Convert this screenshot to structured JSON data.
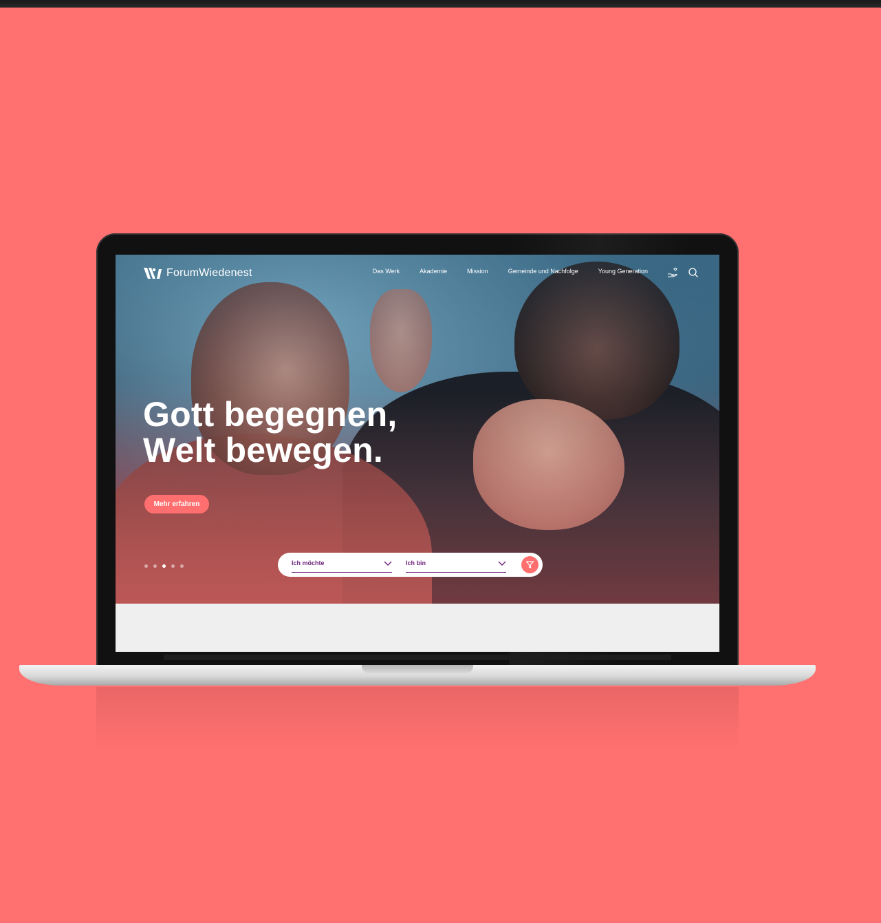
{
  "site": {
    "logo_text": "ForumWiedenest"
  },
  "nav": {
    "items": [
      {
        "label": "Das Werk"
      },
      {
        "label": "Akademie"
      },
      {
        "label": "Mission"
      },
      {
        "label": "Gemeinde und Nachfolge"
      },
      {
        "label": "Young Generation"
      }
    ],
    "icons": [
      "donate-icon",
      "search-icon"
    ]
  },
  "hero": {
    "headline_line1": "Gott begegnen,",
    "headline_line2": "Welt bewegen.",
    "cta_label": "Mehr erfahren",
    "slides": {
      "count": 5,
      "active_index": 2
    }
  },
  "filter": {
    "select1_label": "Ich möchte",
    "select2_label": "Ich bin",
    "button_icon": "filter-icon"
  },
  "colors": {
    "background": "#ff7070",
    "accent": "#ff6f6f",
    "select_text": "#6a1f7a"
  }
}
